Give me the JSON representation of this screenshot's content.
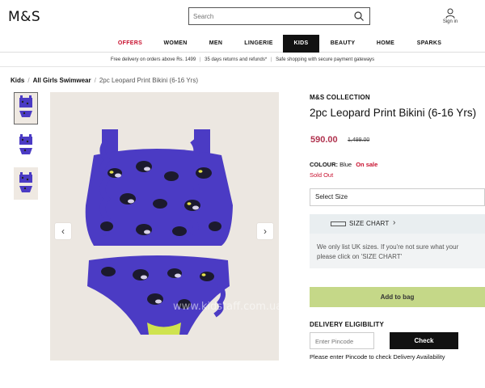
{
  "header": {
    "logo": "M&S",
    "search_placeholder": "Search",
    "signin_label": "Sign in"
  },
  "nav": {
    "items": [
      "OFFERS",
      "WOMEN",
      "MEN",
      "LINGERIE",
      "KIDS",
      "BEAUTY",
      "HOME",
      "SPARKS"
    ],
    "active": "KIDS"
  },
  "promo": {
    "parts": [
      "Free delivery on orders above Rs. 1499",
      "35 days returns and refunds*",
      "Safe shopping with secure payment gateways"
    ],
    "separator": "|"
  },
  "breadcrumb": {
    "items": [
      "Kids",
      "All Girls Swimwear"
    ],
    "separator": "/",
    "current": "2pc Leopard Print Bikini (6-16 Yrs)"
  },
  "gallery": {
    "prev_icon": "chevron-left-icon",
    "next_icon": "chevron-right-icon",
    "watermark": "www.kidstaff.com.ua/user-233127.html"
  },
  "product": {
    "collection": "M&S COLLECTION",
    "title": "2pc Leopard Print Bikini (6-16 Yrs)",
    "price": "590.00",
    "old_price": "1,499.00",
    "colour_label": "COLOUR:",
    "colour_value": "Blue",
    "sale_label": "On sale",
    "stock_status": "Sold Out",
    "size_select": "Select Size",
    "size_chart_label": "SIZE CHART",
    "uk_note": "We only list UK sizes. If you're not sure what your please click on 'SIZE CHART'",
    "add_to_bag": "Add to bag",
    "delivery_heading": "DELIVERY ELIGIBILITY",
    "pincode_placeholder": "Enter Pincode",
    "check_label": "Check",
    "pincode_note": "Please enter Pincode to check Delivery Availability"
  },
  "colors": {
    "price": "#b0324e",
    "sale": "#c8102e",
    "add_to_bag_bg": "#c5d888",
    "nav_active_bg": "#111111",
    "swimsuit": "#4b3bc4"
  }
}
